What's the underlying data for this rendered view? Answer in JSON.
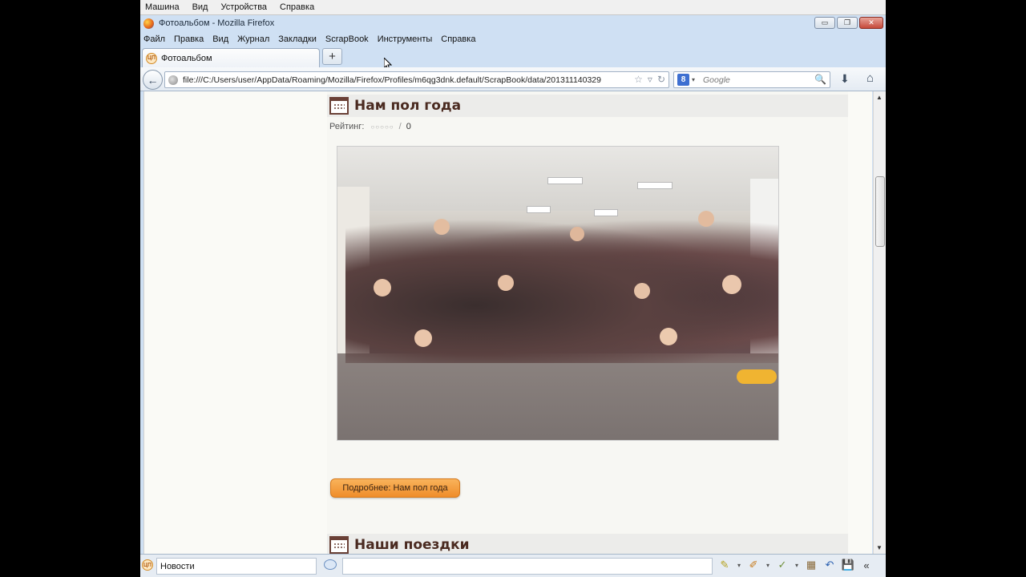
{
  "vbox_menu": [
    "Машина",
    "Вид",
    "Устройства",
    "Справка"
  ],
  "window": {
    "title": "Фотоальбом - Mozilla Firefox",
    "controls": {
      "minimize": "▭",
      "maximize": "❐",
      "close": "✕"
    }
  },
  "menu": [
    "Файл",
    "Правка",
    "Вид",
    "Журнал",
    "Закладки",
    "ScrapBook",
    "Инструменты",
    "Справка"
  ],
  "tab": {
    "label": "Фотоальбом",
    "icon": "page-icon",
    "new_tab": "+"
  },
  "navbar": {
    "back": "←",
    "url": "file:///C:/Users/user/AppData/Roaming/Mozilla/Firefox/Profiles/m6qg3dnk.default/ScrapBook/data/201311140329",
    "url_icons": [
      "☆",
      "▿",
      "↻"
    ],
    "search_engine": "8",
    "search_placeholder": "Google",
    "search_go": "🔍",
    "download": "⬇",
    "home": "⌂"
  },
  "post": {
    "title": "Нам пол года",
    "rating_label": "Рейтинг:",
    "rating_stars": "○○○○○",
    "rating_sep": "/",
    "rating_count": "0",
    "more_button": "Подробнее: Нам пол года"
  },
  "post2": {
    "title": "Наши поездки"
  },
  "scrapbook_bar": {
    "title_value": "Новости",
    "tools": [
      "✎",
      "✐",
      "✓",
      "▦",
      "↶",
      "💾",
      "«"
    ]
  }
}
